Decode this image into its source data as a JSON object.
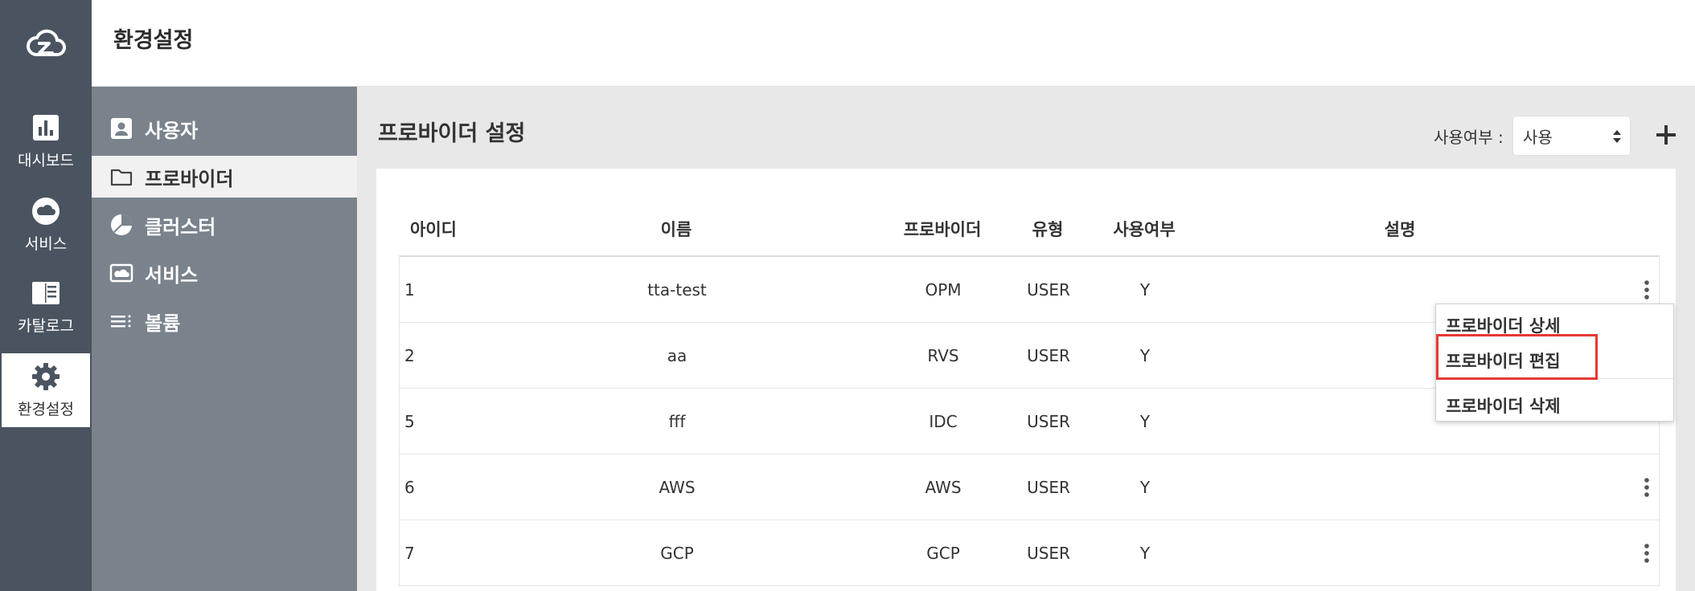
{
  "header": {
    "title": "환경설정"
  },
  "rail": {
    "items": [
      {
        "label": "대시보드",
        "icon": "dashboard-icon"
      },
      {
        "label": "서비스",
        "icon": "cloud-icon"
      },
      {
        "label": "카탈로그",
        "icon": "catalog-icon"
      },
      {
        "label": "환경설정",
        "icon": "gear-icon",
        "active": true
      }
    ]
  },
  "subnav": {
    "items": [
      {
        "label": "사용자",
        "icon": "user-icon"
      },
      {
        "label": "프로바이더",
        "icon": "folder-icon",
        "active": true
      },
      {
        "label": "클러스터",
        "icon": "pie-chart-icon"
      },
      {
        "label": "서비스",
        "icon": "image-icon"
      },
      {
        "label": "볼륨",
        "icon": "list-icon"
      }
    ]
  },
  "main": {
    "title": "프로바이더 설정",
    "filter": {
      "label": "사용여부 :",
      "value": "사용"
    },
    "table": {
      "headers": {
        "id": "아이디",
        "name": "이름",
        "provider": "프로바이더",
        "type": "유형",
        "use": "사용여부",
        "desc": "설명"
      },
      "rows": [
        {
          "id": "1",
          "name": "tta-test",
          "provider": "OPM",
          "type": "USER",
          "use": "Y"
        },
        {
          "id": "2",
          "name": "aa",
          "provider": "RVS",
          "type": "USER",
          "use": "Y"
        },
        {
          "id": "5",
          "name": "fff",
          "provider": "IDC",
          "type": "USER",
          "use": "Y"
        },
        {
          "id": "6",
          "name": "AWS",
          "provider": "AWS",
          "type": "USER",
          "use": "Y"
        },
        {
          "id": "7",
          "name": "GCP",
          "provider": "GCP",
          "type": "USER",
          "use": "Y"
        }
      ]
    }
  },
  "menu": {
    "items": [
      {
        "label": "프로바이더 상세"
      },
      {
        "label": "프로바이더 편집"
      },
      {
        "label": "프로바이더 삭제"
      }
    ]
  },
  "colors": {
    "rail": "#4a5460",
    "subnav": "#7a828c",
    "highlight": "#e53935"
  }
}
